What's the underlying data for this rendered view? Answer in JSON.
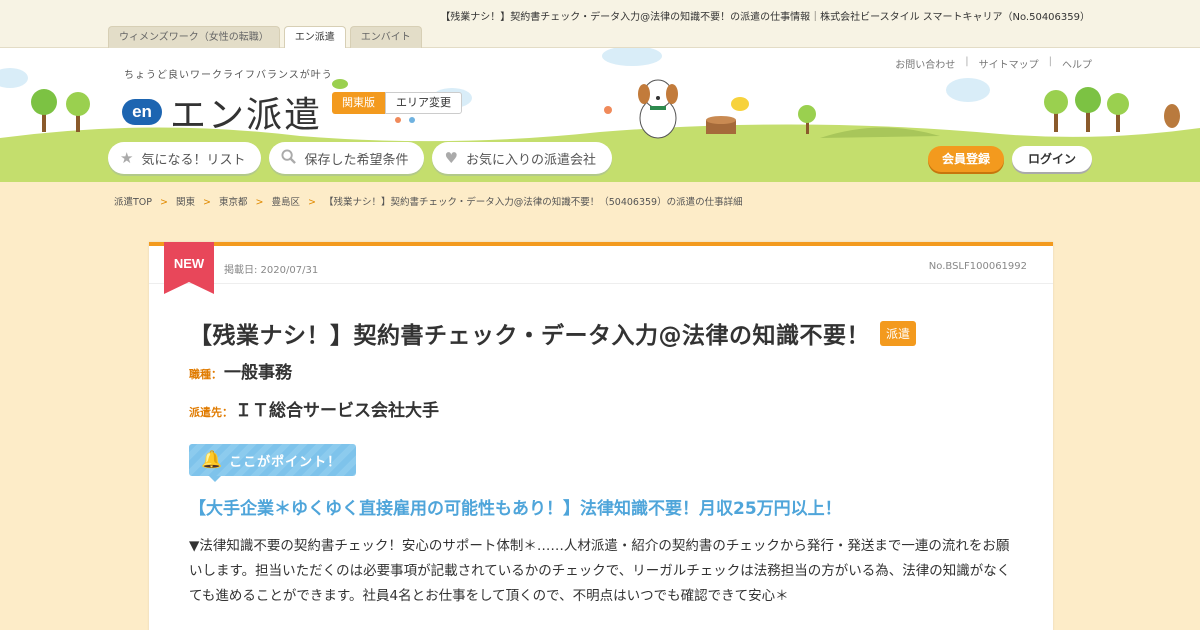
{
  "page": {
    "title_bar": "【残業ナシ！】契約書チェック・データ入力@法律の知識不要！の派遣の仕事情報｜株式会社ビースタイル スマートキャリア（No.50406359）"
  },
  "site_tabs": [
    {
      "label": "ウィメンズワーク（女性の転職）",
      "active": false
    },
    {
      "label": "エン派遣",
      "active": true
    },
    {
      "label": "エンバイト",
      "active": false
    }
  ],
  "header": {
    "tagline": "ちょうど良いワークライフバランスが叶う",
    "logo_mark": "en",
    "logo_text": "エン派遣",
    "region": "関東版",
    "region_change": "エリア変更",
    "util_links": [
      "お問い合わせ",
      "サイトマップ",
      "ヘルプ"
    ],
    "nav": [
      {
        "label": "気になる！リスト",
        "icon": "star-icon"
      },
      {
        "label": "保存した希望条件",
        "icon": "search-icon"
      },
      {
        "label": "お気に入りの派遣会社",
        "icon": "heart-icon"
      }
    ],
    "register": "会員登録",
    "login": "ログイン"
  },
  "breadcrumb": {
    "items": [
      "派遣TOP",
      "関東",
      "東京都",
      "豊島区"
    ],
    "separator": ">",
    "current": "【残業ナシ！】契約書チェック・データ入力@法律の知識不要！（50406359）の派遣の仕事詳細"
  },
  "job": {
    "new_label": "NEW",
    "post_date": "掲載日: 2020/07/31",
    "job_no": "No.BSLF100061992",
    "title": "【残業ナシ！】契約書チェック・データ入力@法律の知識不要！",
    "type_badge": "派遣",
    "category_label": "職種：",
    "category": "一般事務",
    "client_label": "派遣先：",
    "client": "ＩＴ総合サービス会社大手",
    "point_label": "ここがポイント！",
    "catch": "【大手企業＊ゆくゆく直接雇用の可能性もあり！】法律知識不要！月収25万円以上！",
    "description": "▼法律知識不要の契約書チェック！安心のサポート体制＊……人材派遣・紹介の契約書のチェックから発行・発送まで一連の流れをお願いします。担当いただくのは必要事項が記載されているかのチェックで、リーガルチェックは法務担当の方がいる為、法律の知識がなくても進めることができます。社員4名とお仕事をして頂くので、不明点はいつでも確認できて安心＊"
  },
  "colors": {
    "accent": "#f39a1e",
    "ribbon": "#e8475a",
    "catch": "#4fa5da",
    "logo_blue": "#1d65b1",
    "grass": "#c4de6d",
    "page_bg": "#fdecc8"
  }
}
